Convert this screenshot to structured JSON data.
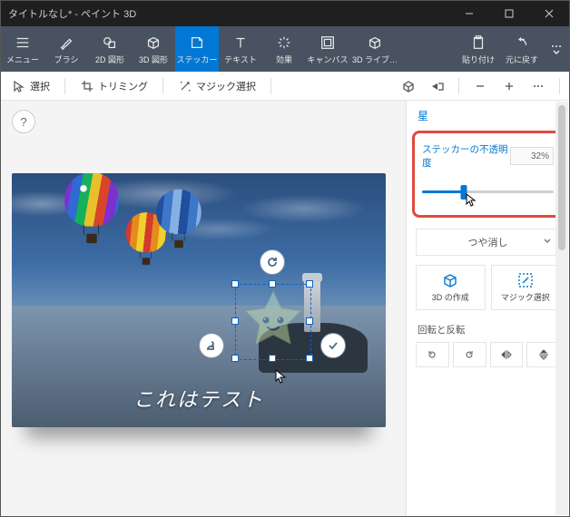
{
  "window": {
    "title": "タイトルなし* - ペイント 3D"
  },
  "ribbon": {
    "items": [
      {
        "label": "メニュー"
      },
      {
        "label": "ブラシ"
      },
      {
        "label": "2D 図形"
      },
      {
        "label": "3D 図形"
      },
      {
        "label": "ステッカー"
      },
      {
        "label": "テキスト"
      },
      {
        "label": "効果"
      },
      {
        "label": "キャンバス"
      },
      {
        "label": "3D ライブ…"
      },
      {
        "label": "貼り付け"
      },
      {
        "label": "元に戻す"
      }
    ]
  },
  "optionsbar": {
    "select": "選択",
    "trimming": "トリミング",
    "magic": "マジック選択"
  },
  "canvas": {
    "help": "?",
    "caption": "これはテスト"
  },
  "panel": {
    "header": "星",
    "opacity": {
      "label": "ステッカーの不透明度",
      "value": "32%",
      "percent": 32
    },
    "matte": "つや消し",
    "make3d": "3D の作成",
    "magic": "マジック選択",
    "rotflip": "回転と反転"
  }
}
